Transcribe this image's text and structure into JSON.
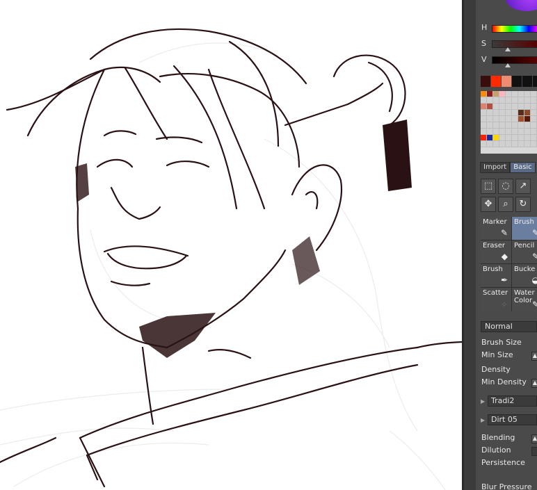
{
  "color_panel": {
    "h_label": "H",
    "s_label": "S",
    "v_label": "V",
    "recent_colors": [
      "#3a0d0d",
      "#ff2a00",
      "#f08a70",
      "#111111",
      "#111111",
      "#111111",
      "#111111",
      "#111111"
    ],
    "palette_colors": [
      "#ff8c00",
      "#8b1a1a",
      "#c8a070",
      "#ffb6c1",
      "#d0d0d0",
      "#d0d0d0",
      "#d0d0d0",
      "#d0d0d0",
      "#d0d0d0",
      "#d0d0d0",
      "#d0d0d0",
      "#d0d0d0",
      "#d0d0d0",
      "#d0d0d0",
      "#d0d0d0",
      "#d0d0d0",
      "#d0d0d0",
      "#d0d0d0",
      "#e08070",
      "#b05040",
      "#d0d0d0",
      "#d0d0d0",
      "#d0d0d0",
      "#d0d0d0",
      "#d0d0d0",
      "#d0d0d0",
      "#d0d0d0",
      "#d0d0d0",
      "#d0d0d0",
      "#d0d0d0",
      "#d0d0d0",
      "#d0d0d0",
      "#d0d0d0",
      "#5a2a1a",
      "#8b4a2a",
      "#d0d0d0",
      "#d0d0d0",
      "#d0d0d0",
      "#d0d0d0",
      "#d0d0d0",
      "#d0d0d0",
      "#d0d0d0",
      "#a0502a",
      "#5a1a0a",
      "#d0d0d0",
      "#d0d0d0",
      "#d0d0d0",
      "#d0d0d0",
      "#d0d0d0",
      "#d0d0d0",
      "#d0d0d0",
      "#d0d0d0",
      "#d0d0d0",
      "#d0d0d0",
      "#d0d0d0",
      "#d0d0d0",
      "#d0d0d0",
      "#d0d0d0",
      "#d0d0d0",
      "#d0d0d0",
      "#d0d0d0",
      "#d0d0d0",
      "#d0d0d0",
      "#ff2000",
      "#1a2a9a",
      "#ffd700",
      "#d0d0d0",
      "#d0d0d0",
      "#d0d0d0",
      "#d0d0d0",
      "#d0d0d0",
      "#d0d0d0",
      "#d0d0d0",
      "#d0d0d0",
      "#d0d0d0",
      "#d0d0d0",
      "#d0d0d0",
      "#d0d0d0",
      "#d0d0d0",
      "#d0d0d0",
      "#d0d0d0"
    ]
  },
  "tabs": {
    "import": "Import",
    "basic": "Basic"
  },
  "tools": [
    "select-rect-icon",
    "lasso-icon",
    "wand-icon",
    "move-icon",
    "zoom-icon",
    "rotate-icon"
  ],
  "brushes": [
    {
      "name": "marker-brush",
      "label": "Marker",
      "icon": "✎"
    },
    {
      "name": "brush-brush-selected",
      "label": "Brush",
      "icon": "✎"
    },
    {
      "name": "eraser-brush",
      "label": "Eraser",
      "icon": "◆"
    },
    {
      "name": "pencil-brush",
      "label": "Pencil",
      "icon": "✎"
    },
    {
      "name": "brush2-brush",
      "label": "Brush",
      "icon": "✒"
    },
    {
      "name": "bucket-brush",
      "label": "Bucke",
      "icon": "◒"
    },
    {
      "name": "scatter-brush",
      "label": "Scatter",
      "icon": "✧"
    },
    {
      "name": "watercolor-brush",
      "label": "Water Color",
      "icon": "✎"
    }
  ],
  "blend_mode": "Normal",
  "props": {
    "brush_size": "Brush Size",
    "min_size": "Min Size",
    "density": "Density",
    "min_density": "Min Density",
    "texture": "Tradi2",
    "pattern": "Dirt 05",
    "blending": "Blending",
    "dilution": "Dilution",
    "persistence": "Persistence",
    "blur_pressure": "Blur Pressure"
  }
}
